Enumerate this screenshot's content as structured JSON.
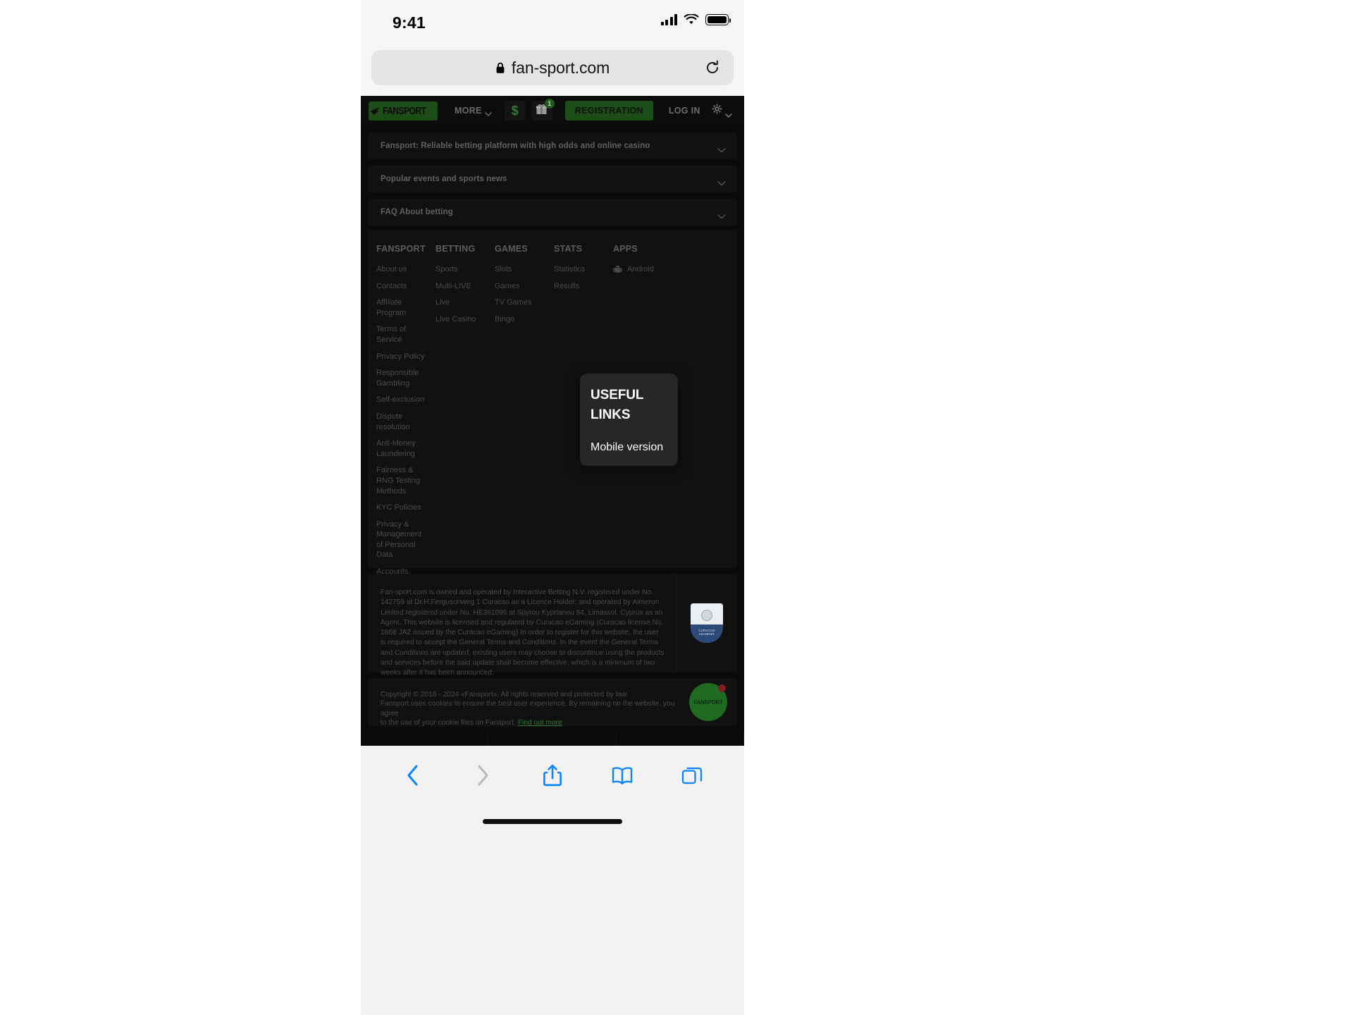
{
  "status_bar": {
    "time": "9:41",
    "signal_icon": "cellular-signal-icon",
    "wifi_icon": "wifi-icon",
    "battery_icon": "battery-full-icon"
  },
  "browser": {
    "url": "fan-sport.com",
    "lock_icon": "lock-icon",
    "reload_icon": "reload-icon",
    "toolbar": {
      "back": "back-chevron-icon",
      "forward": "forward-chevron-icon",
      "share": "share-icon",
      "bookmarks": "book-icon",
      "tabs": "tabs-icon"
    }
  },
  "site_header": {
    "logo_text": "FANSPORT",
    "more_label": "MORE",
    "deposit_icon": "dollar-icon",
    "gift_icon": "gift-icon",
    "gift_badge": "1",
    "registration_label": "REGISTRATION",
    "login_label": "LOG IN",
    "settings_icon": "gear-icon"
  },
  "accordions": [
    {
      "label": "Fansport: Reliable betting platform with high odds and online casino"
    },
    {
      "label": "Popular events and sports news"
    },
    {
      "label": "FAQ About betting"
    }
  ],
  "footer_columns": [
    {
      "title": "FANSPORT",
      "links": [
        "About us",
        "Contacts",
        "Affiliate Program",
        "Terms of Service",
        "Privacy Policy",
        "Responsible Gambling",
        "Self-exclusion",
        "Dispute resolution",
        "Anti-Money Laundering",
        "Fairness & RNG Testing Methods",
        "KYC Policies",
        "Privacy & Management of Personal Data",
        "Accounts, Payouts & Bonuses"
      ]
    },
    {
      "title": "BETTING",
      "links": [
        "Sports",
        "Multi-LIVE",
        "Live",
        "Live Casino"
      ]
    },
    {
      "title": "GAMES",
      "links": [
        "Slots",
        "Games",
        "TV Games",
        "Bingo"
      ]
    },
    {
      "title": "STATS",
      "links": [
        "Statistics",
        "Results"
      ]
    },
    {
      "title": "APPS",
      "links": [
        "Android"
      ]
    }
  ],
  "popover": {
    "title_line1": "USEFUL",
    "title_line2": "LINKS",
    "item": "Mobile version"
  },
  "legal": {
    "text": "Fan-sport.com is owned and operated by Interactive Betting N.V. registered under No. 142759 at Dr.H.Fergusonweg 1 Curacao as a Licence Holder; and operated by Almeron Limited registered under No. HE361095 at Spyrou Kyprianou 84, Limassol, Cyprus as an Agent. This website is licensed and regulated by Curacao eGaming (Curacao license No. 1668 JAZ issued by the Curacao eGaming) In order to register for this website, the user is required to accept the General Terms and Conditions. In the event the General Terms and Conditions are updated, existing users may choose to discontinue using the products and services before the said update shall become effective, which is a minimum of two weeks after it has been announced.",
    "seal_label": "CURACAO eGAMING"
  },
  "copyright": {
    "line1": "Copyright © 2016 - 2024 «Fansport». All rights reserved and protected by law.",
    "line2": "Fansport uses cookies to ensure the best user experience. By remaining on the website, you agree",
    "line3_prefix": "to the use of your cookie files on Fansport. ",
    "link": "Find out more",
    "fab_logo": "FANSPORT"
  },
  "colors": {
    "brand_green": "#1d4d16",
    "accent_green": "#2f7d32",
    "page_bg": "#0a0a0a",
    "panel_bg": "#111111",
    "ios_blue": "#0a84ff",
    "popover_bg": "#262626"
  }
}
